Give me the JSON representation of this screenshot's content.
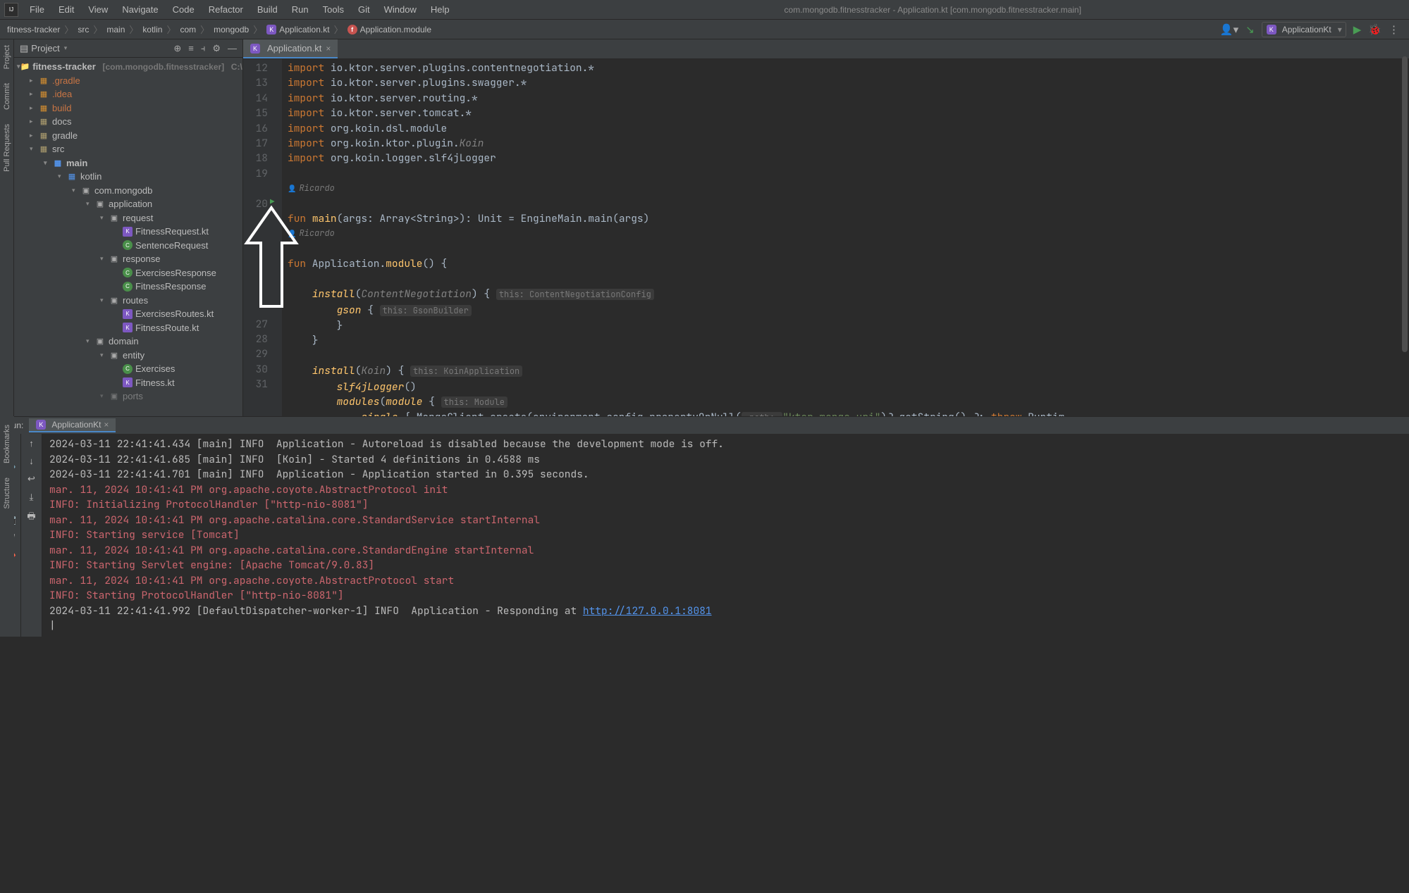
{
  "titlebar": {
    "title": "com.mongodb.fitnesstracker - Application.kt [com.mongodb.fitnesstracker.main]"
  },
  "menu": [
    "File",
    "Edit",
    "View",
    "Navigate",
    "Code",
    "Refactor",
    "Build",
    "Run",
    "Tools",
    "Git",
    "Window",
    "Help"
  ],
  "breadcrumbs": [
    "fitness-tracker",
    "src",
    "main",
    "kotlin",
    "com",
    "mongodb",
    "Application.kt",
    "Application.module"
  ],
  "run_config": "ApplicationKt",
  "project_panel": {
    "title": "Project"
  },
  "tree": {
    "root": "fitness-tracker",
    "root_meta": "[com.mongodb.fitnesstracker]",
    "root_path": "C:\\Users",
    "gradle": ".gradle",
    "idea": ".idea",
    "build": "build",
    "docs": "docs",
    "gradle_dir": "gradle",
    "src": "src",
    "main": "main",
    "kotlin": "kotlin",
    "com_mongodb": "com.mongodb",
    "application": "application",
    "request": "request",
    "fitness_request": "FitnessRequest.kt",
    "sentence_request": "SentenceRequest",
    "response": "response",
    "exercises_response": "ExercisesResponse",
    "fitness_response": "FitnessResponse",
    "routes": "routes",
    "exercises_routes": "ExercisesRoutes.kt",
    "fitness_route": "FitnessRoute.kt",
    "domain": "domain",
    "entity": "entity",
    "exercises": "Exercises",
    "fitness_kt": "Fitness.kt",
    "ports": "ports"
  },
  "editor": {
    "tab": "Application.kt",
    "author": "Ricardo",
    "lines": {
      "l12": {
        "kw": "import",
        "rest": " io.ktor.server.plugins.contentnegotiation.*"
      },
      "l13": {
        "kw": "import",
        "rest": " io.ktor.server.plugins.swagger.*"
      },
      "l14": {
        "kw": "import",
        "rest": " io.ktor.server.routing.*"
      },
      "l15": {
        "kw": "import",
        "rest": " io.ktor.server.tomcat.*"
      },
      "l16": {
        "kw": "import",
        "rest": " org.koin.dsl.module"
      },
      "l17": {
        "kw": "import",
        "pre": " org.koin.ktor.plugin.",
        "it": "Koin"
      },
      "l18": {
        "kw": "import",
        "rest": " org.koin.logger.slf4jLogger"
      },
      "l20": "fun main(args: Array<String>): Unit = EngineMain.main(args)",
      "l21": "fun Application.module() {",
      "l24": "    install(ContentNegotiation) {",
      "l24_hint": "this: ContentNegotiationConfig",
      "l25": "        gson {",
      "l25_hint": "this: GsonBuilder",
      "l26": "        }",
      "l27": "    }",
      "l28": "    install(Koin) {",
      "l28_hint": "this: KoinApplication",
      "l29": "        slf4jLogger()",
      "l30": "        modules(module {",
      "l30_hint": "this: Module",
      "l31_a": "            single { MongoClient.create(environment.config.propertyOrNull(",
      "l31_path": " path: ",
      "l31_str": "\"ktor.mongo.uri\"",
      "l31_b": ")?.getString() ?: ",
      "l31_throw": "throw",
      "l31_c": " Runtim"
    },
    "line_numbers": [
      12,
      13,
      14,
      15,
      16,
      17,
      18,
      19,
      "",
      20,
      "",
      "",
      "",
      "",
      "",
      27,
      28,
      29,
      30,
      31
    ]
  },
  "run": {
    "label": "Run:",
    "tab": "ApplicationKt"
  },
  "console": {
    "l1": "2024-03-11 22:41:41.434 [main] INFO  Application - Autoreload is disabled because the development mode is off.",
    "l2": "2024-03-11 22:41:41.685 [main] INFO  [Koin] - Started 4 definitions in 0.4588 ms",
    "l3": "2024-03-11 22:41:41.701 [main] INFO  Application - Application started in 0.395 seconds.",
    "l4": "mar. 11, 2024 10:41:41 PM org.apache.coyote.AbstractProtocol init",
    "l5": "INFO: Initializing ProtocolHandler [\"http-nio-8081\"]",
    "l6": "mar. 11, 2024 10:41:41 PM org.apache.catalina.core.StandardService startInternal",
    "l7": "INFO: Starting service [Tomcat]",
    "l8": "mar. 11, 2024 10:41:41 PM org.apache.catalina.core.StandardEngine startInternal",
    "l9": "INFO: Starting Servlet engine: [Apache Tomcat/9.0.83]",
    "l10": "mar. 11, 2024 10:41:41 PM org.apache.coyote.AbstractProtocol start",
    "l11": "INFO: Starting ProtocolHandler [\"http-nio-8081\"]",
    "l12a": "2024-03-11 22:41:41.992 [DefaultDispatcher-worker-1] INFO  Application - Responding at ",
    "l12b": "http://127.0.0.1:8081",
    "cursor": "|"
  },
  "rails": {
    "project": "Project",
    "commit": "Commit",
    "pull": "Pull Requests",
    "bookmarks": "Bookmarks",
    "structure": "Structure"
  }
}
